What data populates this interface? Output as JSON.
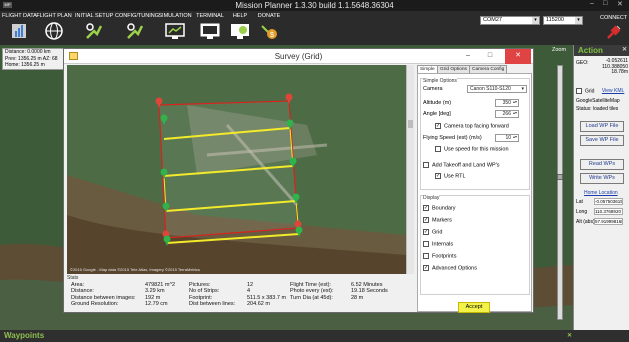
{
  "window": {
    "title": "Mission Planner 1.3.30 build 1.1.5648.36304",
    "logo_text": "MP",
    "min": "–",
    "max": "□",
    "close": "✕"
  },
  "toolbar": {
    "items": [
      {
        "label": "FLIGHT DATA",
        "icon": "flight-data-icon"
      },
      {
        "label": "FLIGHT PLAN",
        "icon": "flight-plan-globe-icon"
      },
      {
        "label": "INITIAL SETUP",
        "icon": "initial-setup-icon"
      },
      {
        "label": "CONFIG/TUNING",
        "icon": "config-tuning-icon"
      },
      {
        "label": "SIMULATION",
        "icon": "simulation-icon"
      },
      {
        "label": "TERMINAL",
        "icon": "terminal-icon"
      },
      {
        "label": "HELP",
        "icon": "help-icon"
      },
      {
        "label": "DONATE",
        "icon": "donate-icon"
      }
    ],
    "port": "COM27",
    "baud": "115200",
    "connect": "CONNECT"
  },
  "hud": {
    "distance": "Distance: 0.0000 km",
    "prev": "Prev: 1356.25 m AZ: 68",
    "home": "Home: 1356.25 m"
  },
  "zoom_label": "Zoom",
  "action_panel": {
    "title": "Action",
    "geo_label": "GEO:",
    "geo_value": "-0.052611 110.388050 18.78m",
    "grid_label": "Grid",
    "view_kml": "View KML",
    "map_type": "GoogleSatelliteMap",
    "status": "Status: loaded tiles",
    "load_wp": "Load WP File",
    "save_wp": "Save WP File",
    "read_wps": "Read WPs",
    "write_wps": "Write WPs",
    "home_location": "Home Location",
    "lat_label": "Lat",
    "lat_value": "-0.0575036154",
    "long_label": "Long",
    "long_value": "110.3768920",
    "alt_label": "Alt (abs)",
    "alt_value": "57.9199981689"
  },
  "waypoints_bar": {
    "title": "Waypoints",
    "close": "✕"
  },
  "dialog": {
    "title": "Survey (Grid)",
    "map_credit": "©2015 Google - Map data ©2015 Tele Atlas, Imagery ©2015 TerraMetrics",
    "stats": {
      "title": "Stats",
      "col1_labels": [
        "Area:",
        "Distance:",
        "Distance between images:",
        "Ground Resolution:"
      ],
      "col1_values": [
        "479821 m^2",
        "3.29 km",
        "192 m",
        "12.79 cm"
      ],
      "col2_labels": [
        "Pictures:",
        "No of Strips:",
        "Footprint:",
        "Dist between lines:"
      ],
      "col2_values": [
        "12",
        "4",
        "511.5 x 383.7 m",
        "204.62 m"
      ],
      "col3_labels": [
        "Flight Time (est):",
        "Photo every (est):",
        "Turn Dia (at 45d):"
      ],
      "col3_values": [
        "6.52 Minutes",
        "19.18 Seconds",
        "28 m"
      ]
    },
    "tabs": [
      "Simple",
      "Grid Options",
      "Camera Config"
    ],
    "simple": {
      "group_title": "Simple Options",
      "camera_label": "Camera",
      "camera_value": "Canon S110-S120",
      "altitude_label": "Altitude (m)",
      "altitude_value": "350",
      "angle_label": "Angle [deg]",
      "angle_value": "266",
      "camera_top_facing": "Camera top facing forward",
      "speed_label": "Flying Speed (est) (m/s)",
      "speed_value": "10",
      "use_speed": "Use speed for this mission",
      "add_takeoff": "Add Takeoff and Land WP's",
      "use_rtl": "Use RTL"
    },
    "display": {
      "title": "Display",
      "options": [
        {
          "label": "Boundary",
          "checked": true
        },
        {
          "label": "Markers",
          "checked": true
        },
        {
          "label": "Grid",
          "checked": true
        },
        {
          "label": "Internals",
          "checked": false
        },
        {
          "label": "Footprints",
          "checked": false
        },
        {
          "label": "Advanced Options",
          "checked": true
        }
      ]
    },
    "accept": "Accept"
  },
  "colors": {
    "grid_line": "#f2ea2a",
    "boundary": "#d8231c",
    "marker_green": "#2fb34a",
    "marker_red": "#e0453a",
    "accent_green": "#7fc241"
  }
}
